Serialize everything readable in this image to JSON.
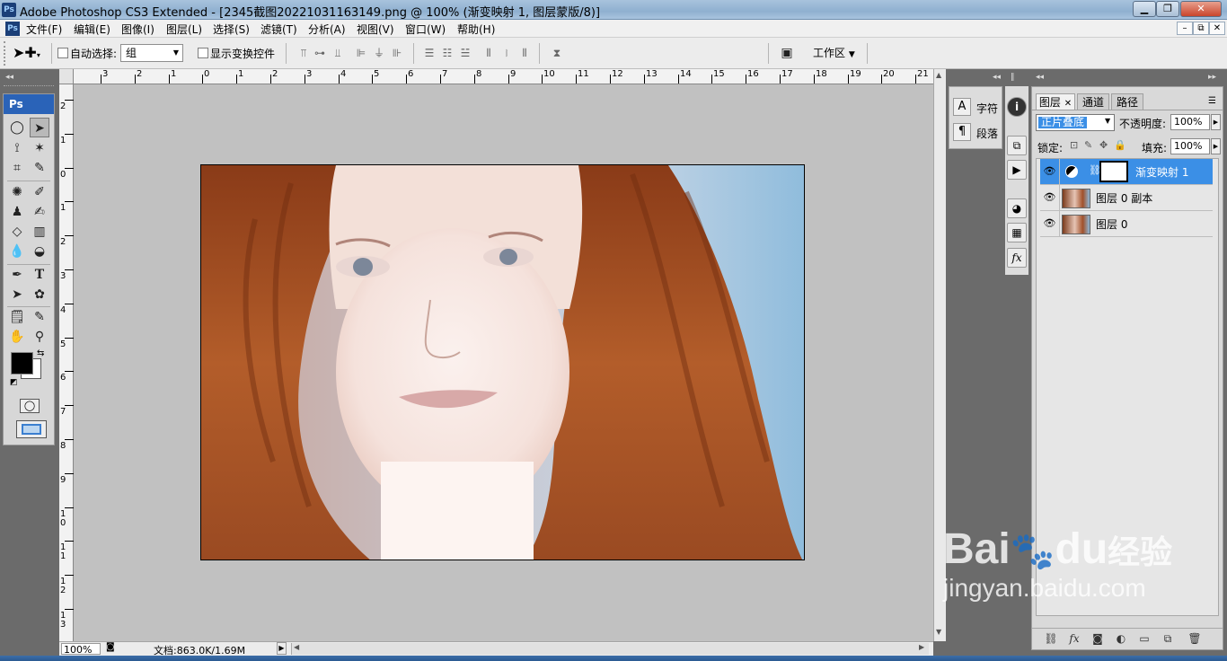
{
  "window": {
    "app_icon": "Ps",
    "title": "Adobe Photoshop CS3 Extended - [2345截图20221031163149.png @ 100% (渐变映射 1, 图层蒙版/8)]",
    "min": "▁",
    "max": "❐",
    "close": "✕"
  },
  "menu": {
    "items": [
      "文件(F)",
      "编辑(E)",
      "图像(I)",
      "图层(L)",
      "选择(S)",
      "滤镜(T)",
      "分析(A)",
      "视图(V)",
      "窗口(W)",
      "帮助(H)"
    ],
    "doc_min": "–",
    "doc_restore": "⧉",
    "doc_close": "✕"
  },
  "options": {
    "move_tool_icon": "move-tool-icon",
    "auto_select_label": "自动选择:",
    "auto_select_value": "组",
    "show_transform_label": "显示变换控件",
    "workspace_label": "工作区"
  },
  "rulers": {
    "top": [
      "3",
      "2",
      "1",
      "0",
      "1",
      "2",
      "3",
      "4",
      "5",
      "6",
      "7",
      "8",
      "9",
      "10",
      "11",
      "12",
      "13",
      "14",
      "15",
      "16",
      "17",
      "18",
      "19",
      "20",
      "21"
    ],
    "left": [
      "2",
      "1",
      "0",
      "1",
      "2",
      "3",
      "4",
      "5",
      "6",
      "7",
      "8",
      "9",
      "1 0",
      "1 1",
      "1 2",
      "1 3"
    ]
  },
  "toolbox": {
    "logo": "Ps"
  },
  "status": {
    "zoom": "100%",
    "doc_info": "文档:863.0K/1.69M"
  },
  "char_panel": {
    "char_label": "字符",
    "para_label": "段落"
  },
  "layers_panel": {
    "tabs": [
      "图层",
      "通道",
      "路径"
    ],
    "blend_mode": "正片叠底",
    "opacity_label": "不透明度:",
    "opacity_value": "100%",
    "lock_label": "锁定:",
    "fill_label": "填充:",
    "fill_value": "100%",
    "layers": [
      {
        "name": "渐变映射 1",
        "selected": true
      },
      {
        "name": "图层 0 副本",
        "selected": false
      },
      {
        "name": "图层 0",
        "selected": false
      }
    ]
  },
  "watermark": {
    "brand": "Bai",
    "brand2": "du",
    "cn": "经验",
    "url": "jingyan.baidu.com"
  },
  "colors": {
    "selection": "#3b8fe6",
    "canvas_bg": "#c1c1c1",
    "toolbox_head": "#2a63b8"
  }
}
